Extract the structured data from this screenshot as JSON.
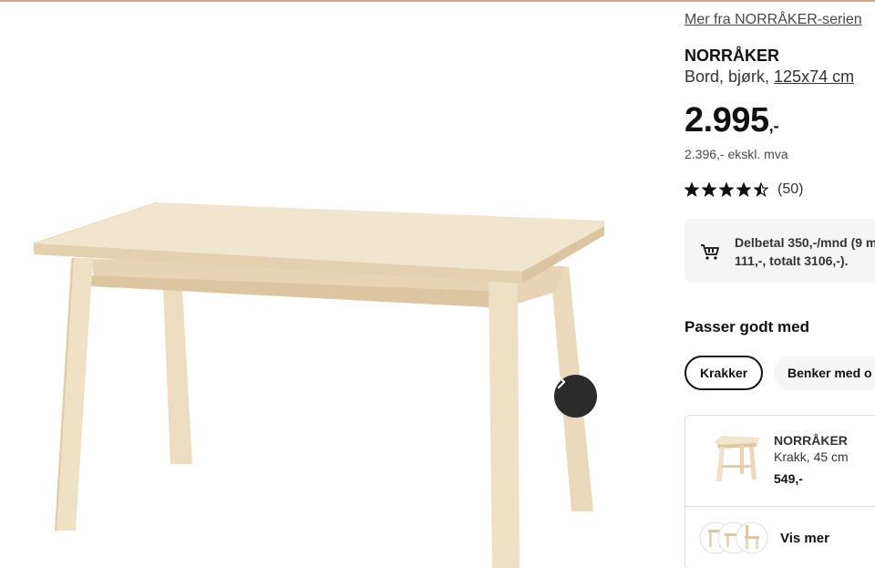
{
  "series_link": "Mer fra NORRÅKER-serien",
  "product": {
    "name": "NORRÅKER",
    "description": "Bord, bjørk, ",
    "size": "125x74 cm",
    "price_main": "2.995",
    "price_suffix": ",-",
    "price_ex_vat": "2.396,- ekskl. mva",
    "rating_stars": 4.5,
    "rating_count": "(50)"
  },
  "installment": {
    "line1": "Delbetal 350,-/mnd (9 m",
    "line2": "111,-, totalt 3106,-)."
  },
  "pairs_well": {
    "heading": "Passer godt med",
    "chips": [
      "Krakker",
      "Benker med o"
    ]
  },
  "recommendation": {
    "name": "NORRÅKER",
    "description": "Krakk, 45 cm",
    "price": "549,-",
    "more_label": "Vis mer"
  },
  "gallery": {
    "icon_next": "chevron-right-icon"
  },
  "colors": {
    "wood_light": "#f1e5cf",
    "wood_mid": "#e8d7b8",
    "wood_edge": "#dcc6a2",
    "button_dark": "#2b2b2b",
    "panel_bg": "#f5f5f5"
  }
}
